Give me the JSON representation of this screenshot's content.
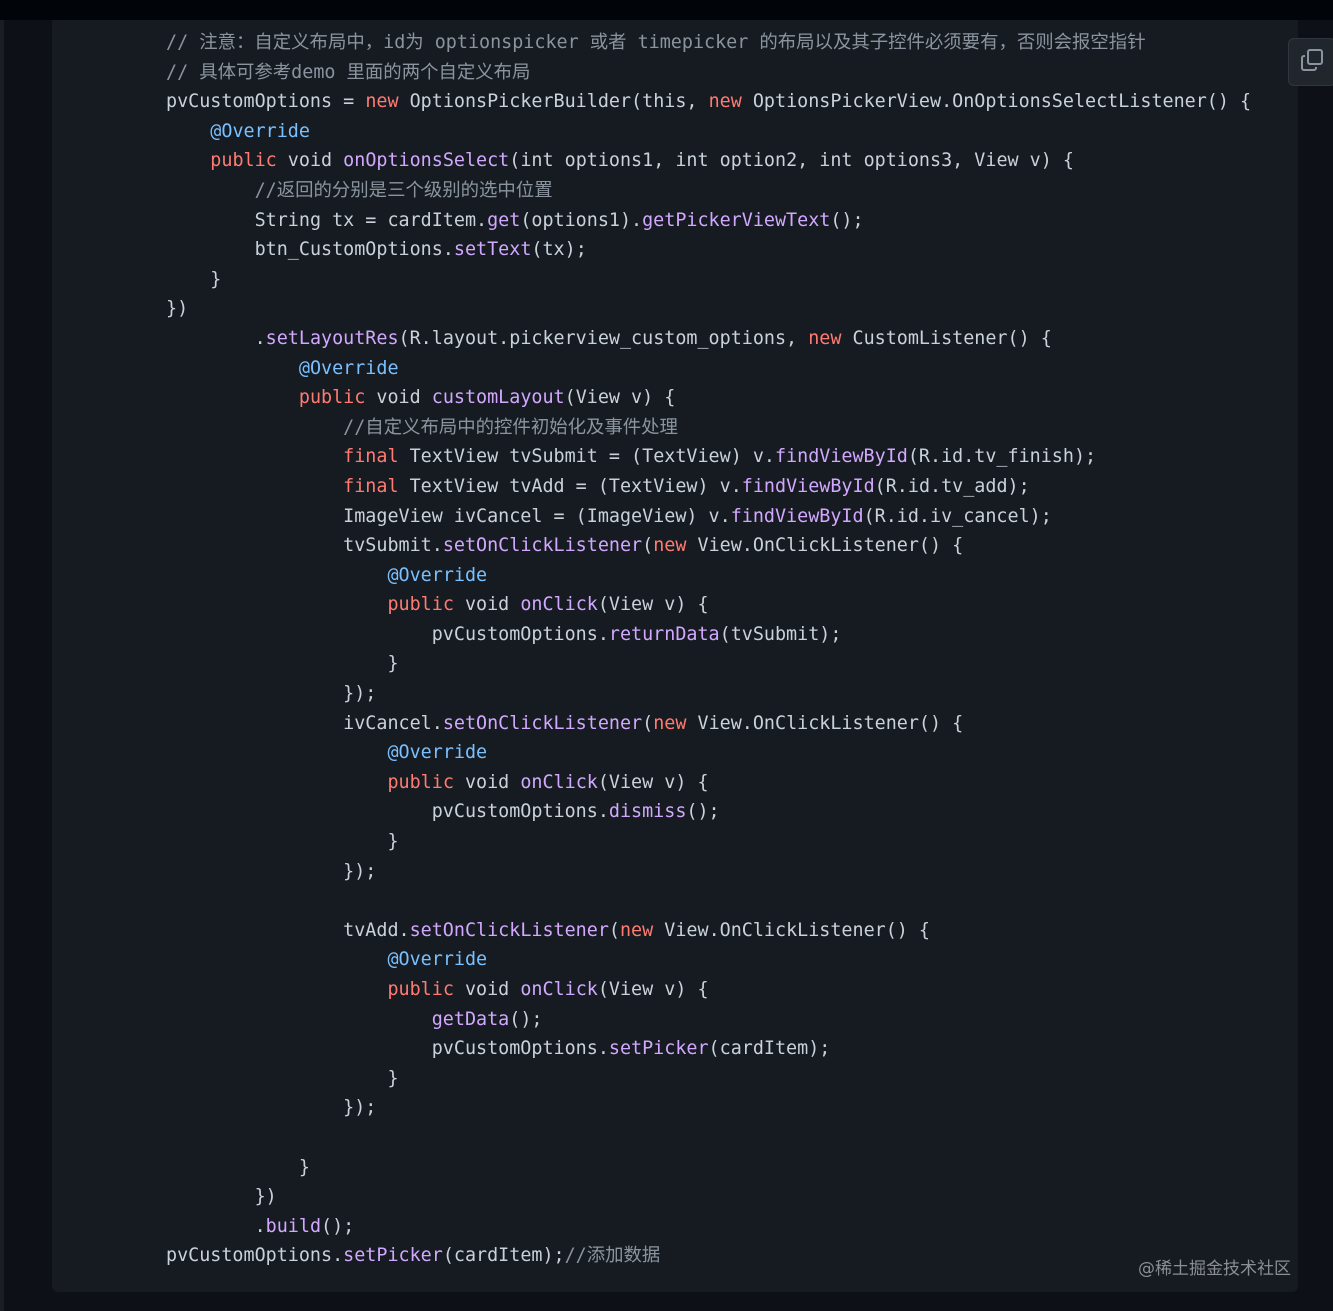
{
  "colors": {
    "page_background": "#0d1117",
    "code_background": "#161b22",
    "plain": "#c9d1d9",
    "comment": "#8b949e",
    "keyword": "#ff7b72",
    "annotation": "#79c0ff",
    "function": "#d2a8ff"
  },
  "copy_button": {
    "icon": "copy-icon"
  },
  "watermark": "@稀土掘金技术社区",
  "code_lines": [
    {
      "indent": 0,
      "tokens": [
        [
          "c",
          "// 注意：自定义布局中，id为 optionspicker 或者 timepicker 的布局以及其子控件必须要有，否则会报空指针"
        ]
      ]
    },
    {
      "indent": 0,
      "tokens": [
        [
          "c",
          "// 具体可参考demo 里面的两个自定义布局"
        ]
      ]
    },
    {
      "indent": 0,
      "tokens": [
        [
          "p",
          "pvCustomOptions = "
        ],
        [
          "k",
          "new"
        ],
        [
          "p",
          " OptionsPickerBuilder(this, "
        ],
        [
          "k",
          "new"
        ],
        [
          "p",
          " OptionsPickerView.OnOptionsSelectListener() {"
        ]
      ]
    },
    {
      "indent": 4,
      "tokens": [
        [
          "a",
          "@Override"
        ]
      ]
    },
    {
      "indent": 4,
      "tokens": [
        [
          "k",
          "public"
        ],
        [
          "p",
          " void "
        ],
        [
          "f",
          "onOptionsSelect"
        ],
        [
          "p",
          "(int options1, int option2, int options3, View v) {"
        ]
      ]
    },
    {
      "indent": 8,
      "tokens": [
        [
          "c",
          "//返回的分别是三个级别的选中位置"
        ]
      ]
    },
    {
      "indent": 8,
      "tokens": [
        [
          "p",
          "String tx = cardItem."
        ],
        [
          "f",
          "get"
        ],
        [
          "p",
          "(options1)."
        ],
        [
          "f",
          "getPickerViewText"
        ],
        [
          "p",
          "();"
        ]
      ]
    },
    {
      "indent": 8,
      "tokens": [
        [
          "p",
          "btn_CustomOptions."
        ],
        [
          "f",
          "setText"
        ],
        [
          "p",
          "(tx);"
        ]
      ]
    },
    {
      "indent": 4,
      "tokens": [
        [
          "p",
          "}"
        ]
      ]
    },
    {
      "indent": 0,
      "tokens": [
        [
          "p",
          "})"
        ]
      ]
    },
    {
      "indent": 8,
      "tokens": [
        [
          "p",
          "."
        ],
        [
          "f",
          "setLayoutRes"
        ],
        [
          "p",
          "(R.layout.pickerview_custom_options, "
        ],
        [
          "k",
          "new"
        ],
        [
          "p",
          " CustomListener() {"
        ]
      ]
    },
    {
      "indent": 12,
      "tokens": [
        [
          "a",
          "@Override"
        ]
      ]
    },
    {
      "indent": 12,
      "tokens": [
        [
          "k",
          "public"
        ],
        [
          "p",
          " void "
        ],
        [
          "f",
          "customLayout"
        ],
        [
          "p",
          "(View v) {"
        ]
      ]
    },
    {
      "indent": 16,
      "tokens": [
        [
          "c",
          "//自定义布局中的控件初始化及事件处理"
        ]
      ]
    },
    {
      "indent": 16,
      "tokens": [
        [
          "k",
          "final"
        ],
        [
          "p",
          " TextView tvSubmit = (TextView) v."
        ],
        [
          "f",
          "findViewById"
        ],
        [
          "p",
          "(R.id.tv_finish);"
        ]
      ]
    },
    {
      "indent": 16,
      "tokens": [
        [
          "k",
          "final"
        ],
        [
          "p",
          " TextView tvAdd = (TextView) v."
        ],
        [
          "f",
          "findViewById"
        ],
        [
          "p",
          "(R.id.tv_add);"
        ]
      ]
    },
    {
      "indent": 16,
      "tokens": [
        [
          "p",
          "ImageView ivCancel = (ImageView) v."
        ],
        [
          "f",
          "findViewById"
        ],
        [
          "p",
          "(R.id.iv_cancel);"
        ]
      ]
    },
    {
      "indent": 16,
      "tokens": [
        [
          "p",
          "tvSubmit."
        ],
        [
          "f",
          "setOnClickListener"
        ],
        [
          "p",
          "("
        ],
        [
          "k",
          "new"
        ],
        [
          "p",
          " View.OnClickListener() {"
        ]
      ]
    },
    {
      "indent": 20,
      "tokens": [
        [
          "a",
          "@Override"
        ]
      ]
    },
    {
      "indent": 20,
      "tokens": [
        [
          "k",
          "public"
        ],
        [
          "p",
          " void "
        ],
        [
          "f",
          "onClick"
        ],
        [
          "p",
          "(View v) {"
        ]
      ]
    },
    {
      "indent": 24,
      "tokens": [
        [
          "p",
          "pvCustomOptions."
        ],
        [
          "f",
          "returnData"
        ],
        [
          "p",
          "(tvSubmit);"
        ]
      ]
    },
    {
      "indent": 20,
      "tokens": [
        [
          "p",
          "}"
        ]
      ]
    },
    {
      "indent": 16,
      "tokens": [
        [
          "p",
          "});"
        ]
      ]
    },
    {
      "indent": 16,
      "tokens": [
        [
          "p",
          "ivCancel."
        ],
        [
          "f",
          "setOnClickListener"
        ],
        [
          "p",
          "("
        ],
        [
          "k",
          "new"
        ],
        [
          "p",
          " View.OnClickListener() {"
        ]
      ]
    },
    {
      "indent": 20,
      "tokens": [
        [
          "a",
          "@Override"
        ]
      ]
    },
    {
      "indent": 20,
      "tokens": [
        [
          "k",
          "public"
        ],
        [
          "p",
          " void "
        ],
        [
          "f",
          "onClick"
        ],
        [
          "p",
          "(View v) {"
        ]
      ]
    },
    {
      "indent": 24,
      "tokens": [
        [
          "p",
          "pvCustomOptions."
        ],
        [
          "f",
          "dismiss"
        ],
        [
          "p",
          "();"
        ]
      ]
    },
    {
      "indent": 20,
      "tokens": [
        [
          "p",
          "}"
        ]
      ]
    },
    {
      "indent": 16,
      "tokens": [
        [
          "p",
          "});"
        ]
      ]
    },
    {
      "indent": 0,
      "tokens": []
    },
    {
      "indent": 16,
      "tokens": [
        [
          "p",
          "tvAdd."
        ],
        [
          "f",
          "setOnClickListener"
        ],
        [
          "p",
          "("
        ],
        [
          "k",
          "new"
        ],
        [
          "p",
          " View.OnClickListener() {"
        ]
      ]
    },
    {
      "indent": 20,
      "tokens": [
        [
          "a",
          "@Override"
        ]
      ]
    },
    {
      "indent": 20,
      "tokens": [
        [
          "k",
          "public"
        ],
        [
          "p",
          " void "
        ],
        [
          "f",
          "onClick"
        ],
        [
          "p",
          "(View v) {"
        ]
      ]
    },
    {
      "indent": 24,
      "tokens": [
        [
          "f",
          "getData"
        ],
        [
          "p",
          "();"
        ]
      ]
    },
    {
      "indent": 24,
      "tokens": [
        [
          "p",
          "pvCustomOptions."
        ],
        [
          "f",
          "setPicker"
        ],
        [
          "p",
          "(cardItem);"
        ]
      ]
    },
    {
      "indent": 20,
      "tokens": [
        [
          "p",
          "}"
        ]
      ]
    },
    {
      "indent": 16,
      "tokens": [
        [
          "p",
          "});"
        ]
      ]
    },
    {
      "indent": 0,
      "tokens": []
    },
    {
      "indent": 12,
      "tokens": [
        [
          "p",
          "}"
        ]
      ]
    },
    {
      "indent": 8,
      "tokens": [
        [
          "p",
          "})"
        ]
      ]
    },
    {
      "indent": 8,
      "tokens": [
        [
          "p",
          "."
        ],
        [
          "f",
          "build"
        ],
        [
          "p",
          "();"
        ]
      ]
    },
    {
      "indent": 0,
      "tokens": [
        [
          "p",
          "pvCustomOptions."
        ],
        [
          "f",
          "setPicker"
        ],
        [
          "p",
          "(cardItem);"
        ],
        [
          "c",
          "//添加数据"
        ]
      ]
    }
  ]
}
